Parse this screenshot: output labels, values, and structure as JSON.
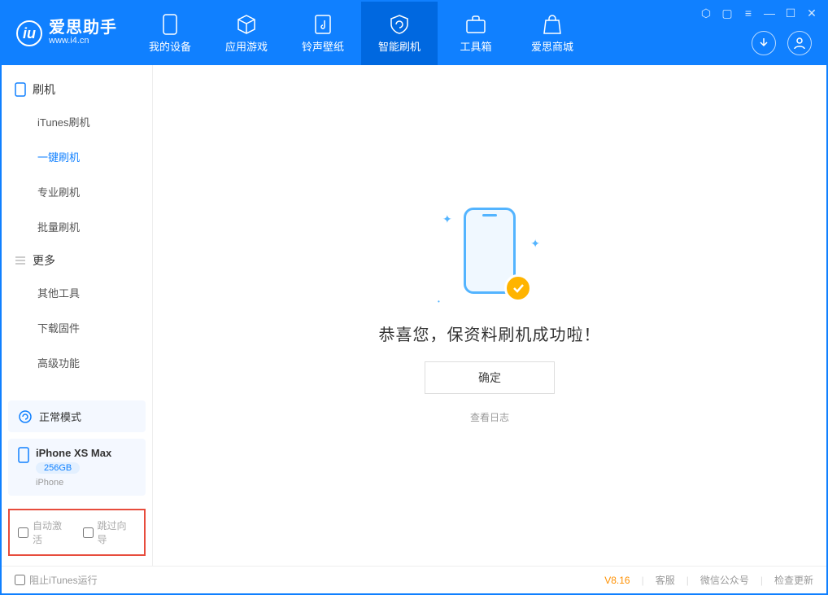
{
  "app": {
    "name_cn": "爱思助手",
    "name_en": "www.i4.cn"
  },
  "tabs": [
    "我的设备",
    "应用游戏",
    "铃声壁纸",
    "智能刷机",
    "工具箱",
    "爱思商城"
  ],
  "active_tab_index": 3,
  "sidebar": {
    "group1_title": "刷机",
    "group1_items": [
      "iTunes刷机",
      "一键刷机",
      "专业刷机",
      "批量刷机"
    ],
    "group1_active_index": 1,
    "group2_title": "更多",
    "group2_items": [
      "其他工具",
      "下载固件",
      "高级功能"
    ]
  },
  "device": {
    "mode_label": "正常模式",
    "name": "iPhone XS Max",
    "storage": "256GB",
    "type": "iPhone"
  },
  "options": {
    "auto_activate_label": "自动激活",
    "skip_guide_label": "跳过向导"
  },
  "main": {
    "success_msg": "恭喜您，保资料刷机成功啦！",
    "ok_button": "确定",
    "view_log": "查看日志"
  },
  "footer": {
    "block_itunes_label": "阻止iTunes运行",
    "version": "V8.16",
    "links": [
      "客服",
      "微信公众号",
      "检查更新"
    ]
  }
}
